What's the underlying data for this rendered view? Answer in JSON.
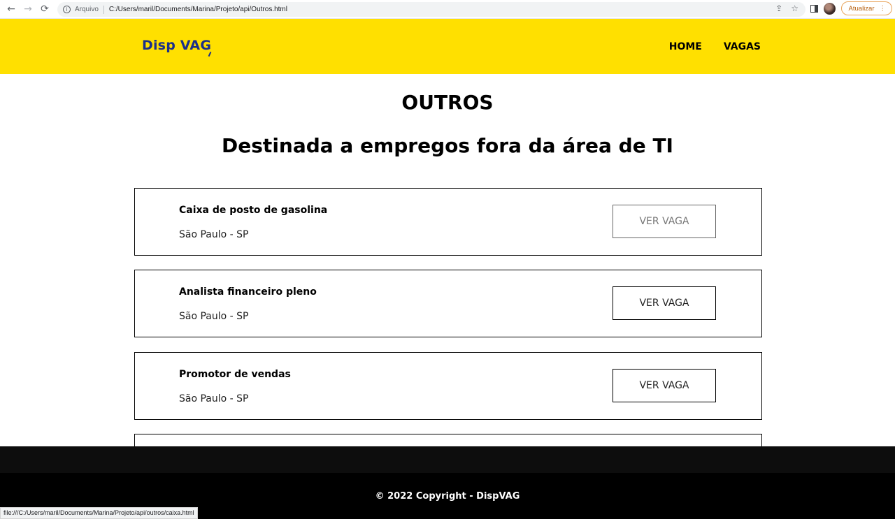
{
  "browser": {
    "back_glyph": "←",
    "forward_glyph": "→",
    "reload_glyph": "⟳",
    "info_glyph": "i",
    "protocol_label": "Arquivo",
    "url": "C:/Users/maril/Documents/Marina/Projeto/api/Outros.html",
    "update_label": "Atualizar",
    "menu_glyph": "⋮",
    "share_glyph": "⇪",
    "star_glyph": "☆"
  },
  "header": {
    "logo_text_1": "Disp VA",
    "logo_text_2": "G",
    "nav": [
      {
        "label": "HOME"
      },
      {
        "label": "VAGAS"
      }
    ],
    "background_color": "#ffe000",
    "logo_color": "#1b2f8a"
  },
  "main": {
    "title": "OUTROS",
    "subtitle": "Destinada a empregos fora da área de TI",
    "jobs": [
      {
        "title": "Caixa de posto de gasolina",
        "location": "São Paulo - SP",
        "button_label": "VER VAGA"
      },
      {
        "title": "Analista financeiro pleno",
        "location": "São Paulo - SP",
        "button_label": "VER VAGA"
      },
      {
        "title": "Promotor de vendas",
        "location": "São Paulo - SP",
        "button_label": "VER VAGA"
      }
    ]
  },
  "footer": {
    "copyright": "© 2022 Copyright - DispVAG"
  },
  "status_bar": {
    "link_url": "file:///C:/Users/maril/Documents/Marina/Projeto/api/outros/caixa.html"
  }
}
